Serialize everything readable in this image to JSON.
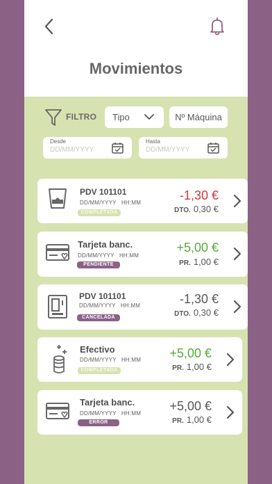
{
  "header": {
    "title": "Movimientos"
  },
  "filters": {
    "filter_label": "FILTRO",
    "tipo_label": "Tipo",
    "maquina_label": "Nº Máquina",
    "desde_label": "Desde",
    "desde_placeholder": "DD/MM/YYYY",
    "hasta_label": "Hasta",
    "hasta_placeholder": "DD/MM/YYYY"
  },
  "movements": [
    {
      "icon": "cup-icon",
      "name": "PDV 101101",
      "date": "DD/MM/YYYY",
      "time": "HH:MM",
      "status": "COMPLETADA",
      "amount": "-1,30 €",
      "sub_label": "DTO.",
      "sub_value": "0,30 €",
      "amount_color": "#d4373d"
    },
    {
      "icon": "bank-card-icon",
      "name": "Tarjeta banc.",
      "date": "DD/MM/YYYY",
      "time": "HH:MM",
      "status": "PENDIENTE",
      "amount": "+5,00 €",
      "sub_label": "PR.",
      "sub_value": "1,00 €",
      "amount_color": "#58a83d"
    },
    {
      "icon": "vending-machine-icon",
      "name": "PDV 101101",
      "date": "DD/MM/YYYY",
      "time": "HH:MM",
      "status": "CANCELADA",
      "amount": "-1,30 €",
      "sub_label": "DTO.",
      "sub_value": "0,30 €",
      "amount_color": "#585858"
    },
    {
      "icon": "coins-icon",
      "name": "Efectivo",
      "date": "DD/MM/YYYY",
      "time": "HH:MM",
      "status": "COMPLETADA",
      "amount": "+5,00 €",
      "sub_label": "PR.",
      "sub_value": "1,00 €",
      "amount_color": "#58a83d"
    },
    {
      "icon": "bank-card-icon",
      "name": "Tarjeta banc.",
      "date": "DD/MM/YYYY",
      "time": "HH:MM",
      "status": "ERROR",
      "amount": "+5,00 €",
      "sub_label": "PR.",
      "sub_value": "1,00 €",
      "amount_color": "#585858"
    }
  ],
  "colors": {
    "frame": "#8c6186",
    "background": "#d7e2b1",
    "negative": "#d4373d",
    "positive": "#58a83d",
    "badge": "#8c6186"
  }
}
